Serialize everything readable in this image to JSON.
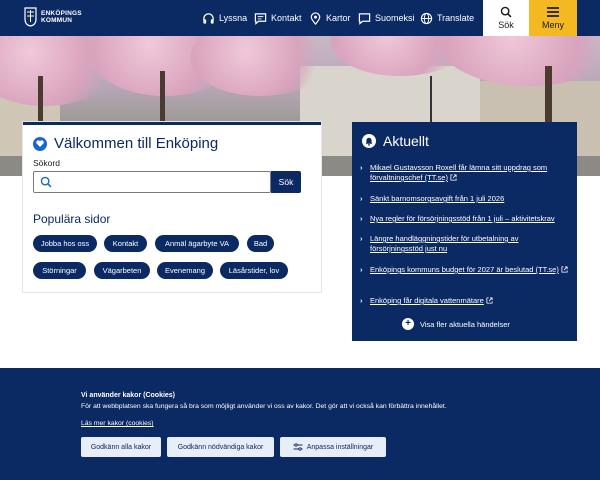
{
  "header": {
    "logo_line1": "ENKÖPINGS",
    "logo_line2": "KOMMUN",
    "nav": [
      {
        "label": "Lyssna",
        "icon": "headphones-icon"
      },
      {
        "label": "Kontakt",
        "icon": "chat-icon"
      },
      {
        "label": "Kartor",
        "icon": "map-pin-icon"
      },
      {
        "label": "Suomeksi",
        "icon": "speech-bubble-icon"
      },
      {
        "label": "Translate",
        "icon": "globe-icon"
      }
    ],
    "search_label": "Sök",
    "menu_label": "Meny"
  },
  "welcome": {
    "title": "Välkommen till Enköping",
    "search_label": "Sökord",
    "search_value": "",
    "search_button": "Sök",
    "popular_title": "Populära sidor",
    "chips": [
      "Jobba hos oss",
      "Kontakt",
      "Anmäl ägarbyte VA",
      "Bad",
      "Störningar",
      "Vägarbeten",
      "Evenemang",
      "Läsårstider, lov"
    ]
  },
  "news": {
    "title": "Aktuellt",
    "items": [
      {
        "text": "Mikael Gustavsson Roxell får lämna sitt uppdrag som förvaltningschef (TT.se)",
        "external": true
      },
      {
        "text": "Sänkt barnomsorgsavgift från 1 juli 2026",
        "external": false
      },
      {
        "text": "Nya regler för försörjningsstöd från 1 juli – aktivitetskrav",
        "external": false
      },
      {
        "text": "Längre handläggningstider för utbetalning av försörjningsstöd just nu",
        "external": false
      },
      {
        "text": "Enköpings kommuns budget för 2027 är beslutad (TT.se)",
        "external": true
      },
      {
        "text": "Enköping får digitala vattenmätare",
        "external": true
      }
    ],
    "more_label": "Visa fler aktuella händelser"
  },
  "cookie": {
    "title": "Vi använder kakor (Cookies)",
    "text": "För att webbplatsen ska fungera så bra som möjligt använder vi oss av kakor. Det gör att vi också kan förbättra innehållet.",
    "link": "Läs mer kakor (cookies)",
    "buttons": [
      "Godkänn alla kakor",
      "Godkänn nödvändiga kakor",
      "Anpassa inställningar"
    ]
  },
  "colors": {
    "brand_navy": "#0b2a63",
    "menu_yellow": "#f4b820",
    "accent_blue": "#1b66c9"
  }
}
